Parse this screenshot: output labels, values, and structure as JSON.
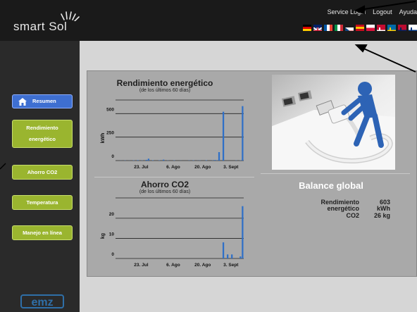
{
  "brand": {
    "logo_text": "smart Sol",
    "footer_logo_text": "emz"
  },
  "topnav": {
    "service_login": "Service Login",
    "logout": "Logout",
    "help": "Ayuda"
  },
  "languages": [
    "de",
    "en",
    "fr",
    "it",
    "cz",
    "es",
    "pl",
    "dk",
    "se",
    "no",
    "fi"
  ],
  "sidebar": {
    "items": [
      {
        "label": "Resumen",
        "active": true
      },
      {
        "label": "Rendimiento energético"
      },
      {
        "label": "Ahorro CO2"
      },
      {
        "label": "Temperatura"
      },
      {
        "label": "Manejo en línea"
      }
    ]
  },
  "charts": {
    "energy": {
      "title": "Rendimiento energético",
      "subtitle": "(de los últimos 60 días)"
    },
    "co2": {
      "title": "Ahorro CO2",
      "subtitle": "(de los últimos 60 días)"
    }
  },
  "chart_data": [
    {
      "type": "bar",
      "title": "Rendimiento energético",
      "subtitle": "(de los últimos 60 días)",
      "ylabel": "kWh",
      "ylim": [
        0,
        600
      ],
      "yticks": [
        "0",
        "250",
        "500"
      ],
      "xticks": [
        "23. Jul",
        "6. Ago",
        "20. Ago",
        "3. Sept"
      ],
      "values": [
        0,
        0,
        1,
        0,
        2,
        0,
        1,
        0,
        3,
        0,
        5,
        0,
        2,
        0,
        8,
        20,
        0,
        4,
        0,
        0,
        3,
        0,
        10,
        0,
        2,
        0,
        0,
        3,
        0,
        0,
        1,
        0,
        0,
        0,
        2,
        0,
        3,
        0,
        1,
        2,
        0,
        0,
        4,
        0,
        0,
        2,
        6,
        3,
        90,
        0,
        520,
        0,
        0,
        0,
        0,
        0,
        2,
        0,
        3,
        580
      ]
    },
    {
      "type": "bar",
      "title": "Ahorro CO2",
      "subtitle": "(de los últimos 60 días)",
      "ylabel": "kg",
      "ylim": [
        0,
        28
      ],
      "yticks": [
        "0",
        "10",
        "20"
      ],
      "xticks": [
        "23. Jul",
        "6. Ago",
        "20. Ago",
        "3. Sept"
      ],
      "values": [
        0,
        0,
        0,
        0,
        0,
        0,
        0,
        0,
        0,
        0,
        0,
        0,
        0,
        0,
        0,
        0,
        0,
        0,
        0,
        0,
        0,
        0,
        0,
        0,
        0,
        0,
        0,
        0,
        0,
        0,
        0,
        0,
        0,
        0,
        0,
        0,
        0,
        0,
        0,
        0,
        0,
        0,
        0,
        0,
        0,
        0,
        0,
        0,
        0,
        0,
        8,
        0,
        2,
        0,
        2,
        0,
        0,
        0,
        1,
        26
      ]
    }
  ],
  "balance": {
    "title": "Balance global",
    "energy_label": "Rendimiento energético",
    "energy_value": "603",
    "energy_unit": "kWh",
    "co2_label": "CO2",
    "co2_value": "26 kg"
  },
  "colors": {
    "accent_green": "#9ab52f",
    "accent_blue": "#3e6fd1",
    "bar": "#2e6fc7"
  }
}
